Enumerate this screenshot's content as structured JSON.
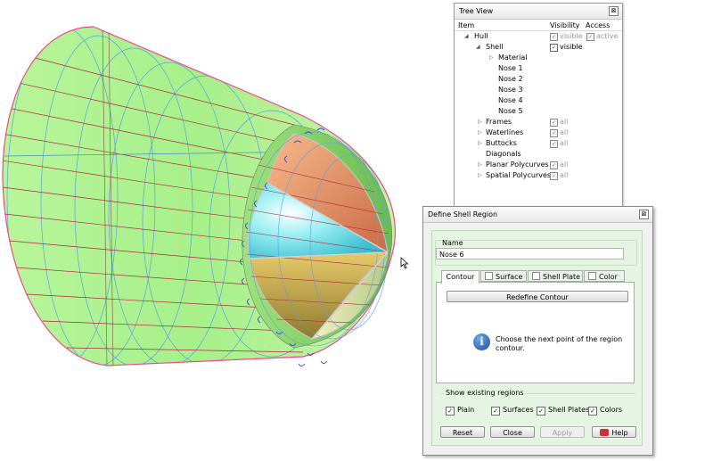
{
  "tree_view": {
    "title": "Tree View",
    "close_glyph": "⊠",
    "columns": {
      "item": "Item",
      "visibility": "Visibility",
      "access": "Access"
    },
    "rows": [
      {
        "label": "Hull",
        "visibility": "visible",
        "access": "active"
      },
      {
        "label": "Shell",
        "visibility": "visible"
      },
      {
        "label": "Material"
      },
      {
        "label": "Nose 1"
      },
      {
        "label": "Nose 2"
      },
      {
        "label": "Nose 3"
      },
      {
        "label": "Nose 4"
      },
      {
        "label": "Nose 5"
      },
      {
        "label": "Frames",
        "visibility": "all"
      },
      {
        "label": "Waterlines",
        "visibility": "all"
      },
      {
        "label": "Buttocks",
        "visibility": "all"
      },
      {
        "label": "Diagonals"
      },
      {
        "label": "Planar Polycurves",
        "visibility": "all"
      },
      {
        "label": "Spatial Polycurves",
        "visibility": "all"
      }
    ]
  },
  "dialog": {
    "title": "Define Shell Region",
    "close_glyph": "⊠",
    "name_legend": "Name",
    "name_value": "Nose 6",
    "tabs": [
      "Contour",
      "Surface",
      "Shell Plate",
      "Color"
    ],
    "redefine_button": "Redefine Contour",
    "info_icon": "i",
    "info_line1": "Choose the next point of the region",
    "info_line2": "contour.",
    "existing_legend": "Show existing regions",
    "existing_checks": [
      "Plain",
      "Surfaces",
      "Shell Plates",
      "Colors"
    ],
    "check_glyph": "✓",
    "buttons": {
      "reset": "Reset",
      "close": "Close",
      "apply": "Apply",
      "help": "Help"
    }
  },
  "colors": {
    "hull_green": "#a6f08a",
    "frame_blue": "#5aa0e6",
    "waterline_red": "#b0243a",
    "accent_pink": "#ee4a8a"
  }
}
